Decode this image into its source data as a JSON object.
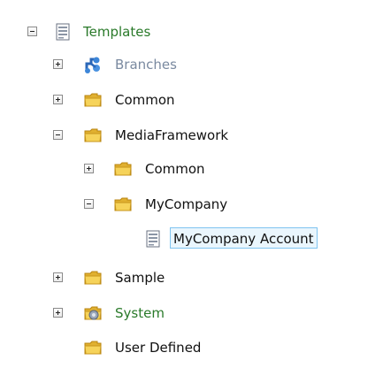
{
  "tree": {
    "nodes": [
      {
        "label": "Templates",
        "color": "#2a7a2a",
        "icon": "template-icon",
        "toggle": "minus"
      },
      {
        "label": "Branches",
        "color": "#7a8aa0",
        "icon": "branches-icon",
        "toggle": "plus"
      },
      {
        "label": "Common",
        "color": "#111111",
        "icon": "folder-icon",
        "toggle": "plus"
      },
      {
        "label": "MediaFramework",
        "color": "#111111",
        "icon": "folder-icon",
        "toggle": "minus"
      },
      {
        "label": "Common",
        "color": "#111111",
        "icon": "folder-icon",
        "toggle": "plus"
      },
      {
        "label": "MyCompany",
        "color": "#111111",
        "icon": "folder-icon",
        "toggle": "minus"
      },
      {
        "label": "MyCompany Account",
        "color": "#111111",
        "icon": "template-icon",
        "toggle": "none",
        "selected": true
      },
      {
        "label": "Sample",
        "color": "#111111",
        "icon": "folder-icon",
        "toggle": "plus"
      },
      {
        "label": "System",
        "color": "#2a7a2a",
        "icon": "system-folder-icon",
        "toggle": "plus"
      },
      {
        "label": "User Defined",
        "color": "#111111",
        "icon": "folder-icon",
        "toggle": "none"
      }
    ]
  }
}
